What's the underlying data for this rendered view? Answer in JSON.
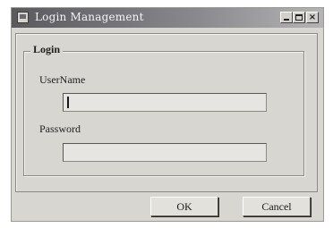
{
  "window": {
    "title": "Login Management",
    "controls": {
      "close_glyph": "×"
    }
  },
  "login_group": {
    "title": "Login",
    "username": {
      "label": "UserName",
      "value": ""
    },
    "password": {
      "label": "Password",
      "value": ""
    }
  },
  "buttons": {
    "ok_label": "OK",
    "cancel_label": "Cancel"
  },
  "icons": {
    "app": "app-icon",
    "minimize": "minimize-icon",
    "maximize": "maximize-icon",
    "close": "close-icon"
  },
  "colors": {
    "titlebar_dark": "#5a5a5e",
    "titlebar_light": "#b4b4b6",
    "window_face": "#d8d6d0",
    "input_face": "#e6e5e1"
  }
}
